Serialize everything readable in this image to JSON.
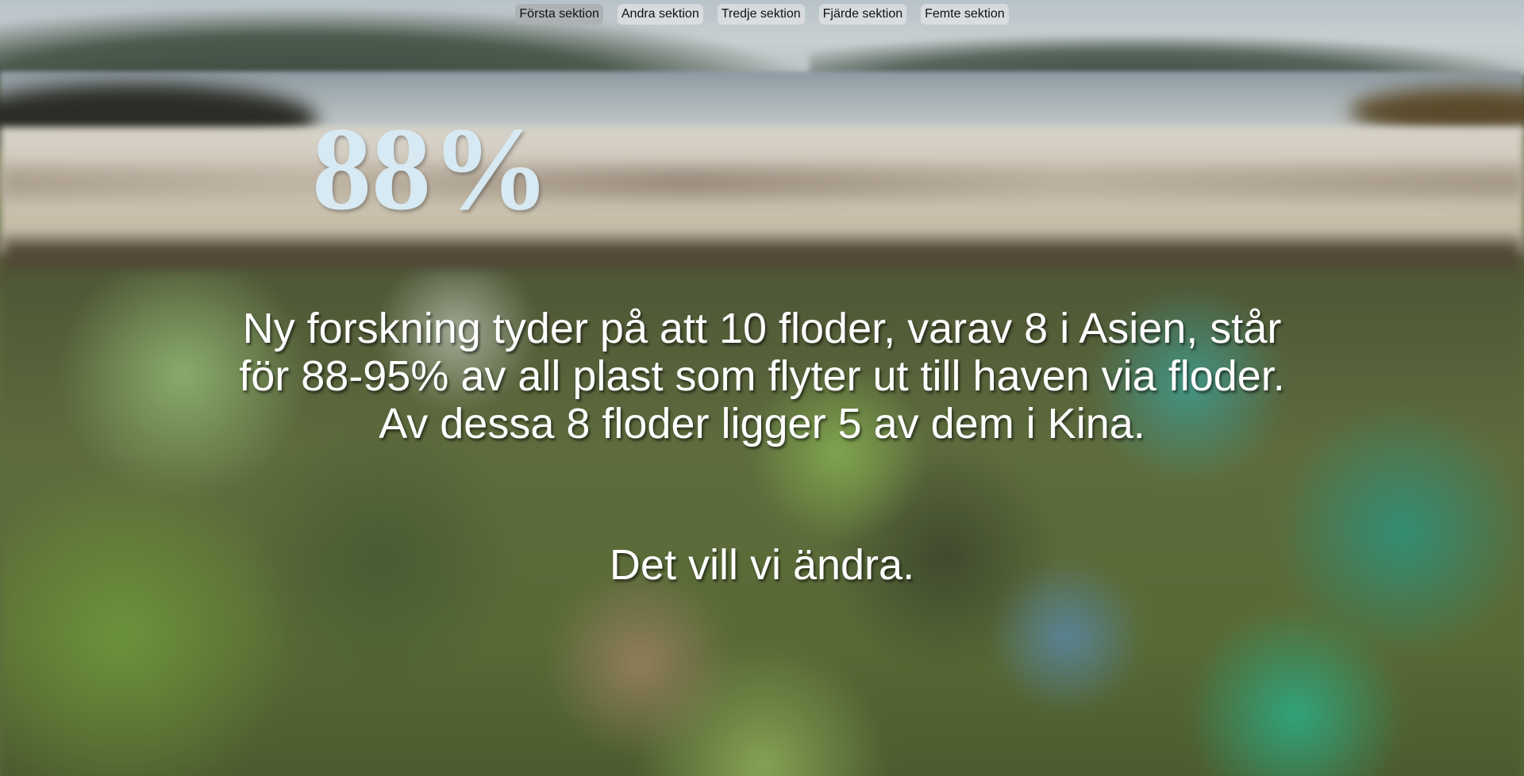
{
  "nav": {
    "items": [
      {
        "label": "Första sektion",
        "active": true
      },
      {
        "label": "Andra sektion",
        "active": false
      },
      {
        "label": "Tredje sektion",
        "active": false
      },
      {
        "label": "Fjärde sektion",
        "active": false
      },
      {
        "label": "Femte sektion",
        "active": false
      }
    ]
  },
  "hero": {
    "stat": "88%",
    "stat_color": "#d7e9f2",
    "lines": [
      "Ny forskning tyder på att 10 floder, varav 8 i Asien, står",
      "för 88-95% av all plast som flyter ut till haven via floder.",
      "Av dessa 8 floder ligger 5 av dem i Kina."
    ],
    "closing": "Det vill vi ändra."
  }
}
